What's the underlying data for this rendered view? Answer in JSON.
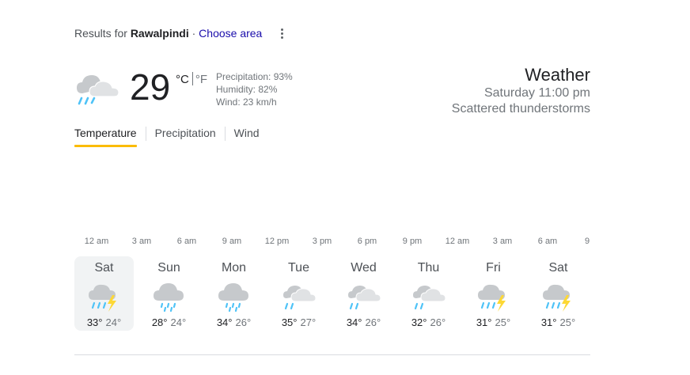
{
  "header": {
    "results_prefix": "Results for",
    "location": "Rawalpindi",
    "separator": "·",
    "choose_area": "Choose area"
  },
  "current": {
    "temperature": "29",
    "unit_c": "°C",
    "unit_f": "°F",
    "precipitation": "Precipitation: 93%",
    "humidity": "Humidity: 82%",
    "wind": "Wind: 23 km/h",
    "icon": "rain-cloud-sun-icon"
  },
  "summary": {
    "title": "Weather",
    "time": "Saturday 11:00 pm",
    "condition": "Scattered thunderstorms"
  },
  "tabs": [
    "Temperature",
    "Precipitation",
    "Wind"
  ],
  "hours": [
    "12 am",
    "3 am",
    "6 am",
    "9 am",
    "12 pm",
    "3 pm",
    "6 pm",
    "9 pm",
    "12 am",
    "3 am",
    "6 am",
    "9"
  ],
  "days": [
    {
      "name": "Sat",
      "hi": "33°",
      "lo": "24°",
      "icon": "thunderstorm-icon"
    },
    {
      "name": "Sun",
      "hi": "28°",
      "lo": "24°",
      "icon": "rain-icon"
    },
    {
      "name": "Mon",
      "hi": "34°",
      "lo": "26°",
      "icon": "rain-icon"
    },
    {
      "name": "Tue",
      "hi": "35°",
      "lo": "27°",
      "icon": "scattered-showers-icon"
    },
    {
      "name": "Wed",
      "hi": "34°",
      "lo": "26°",
      "icon": "scattered-showers-icon"
    },
    {
      "name": "Thu",
      "hi": "32°",
      "lo": "26°",
      "icon": "scattered-showers-icon"
    },
    {
      "name": "Fri",
      "hi": "31°",
      "lo": "25°",
      "icon": "thunderstorm-icon"
    },
    {
      "name": "Sat",
      "hi": "31°",
      "lo": "25°",
      "icon": "thunderstorm-icon"
    }
  ],
  "colors": {
    "accent": "#fbbc04",
    "link": "#1a0dab",
    "cloud": "#c6c9cc",
    "rain": "#4fc3f7",
    "bolt": "#fdd835"
  }
}
